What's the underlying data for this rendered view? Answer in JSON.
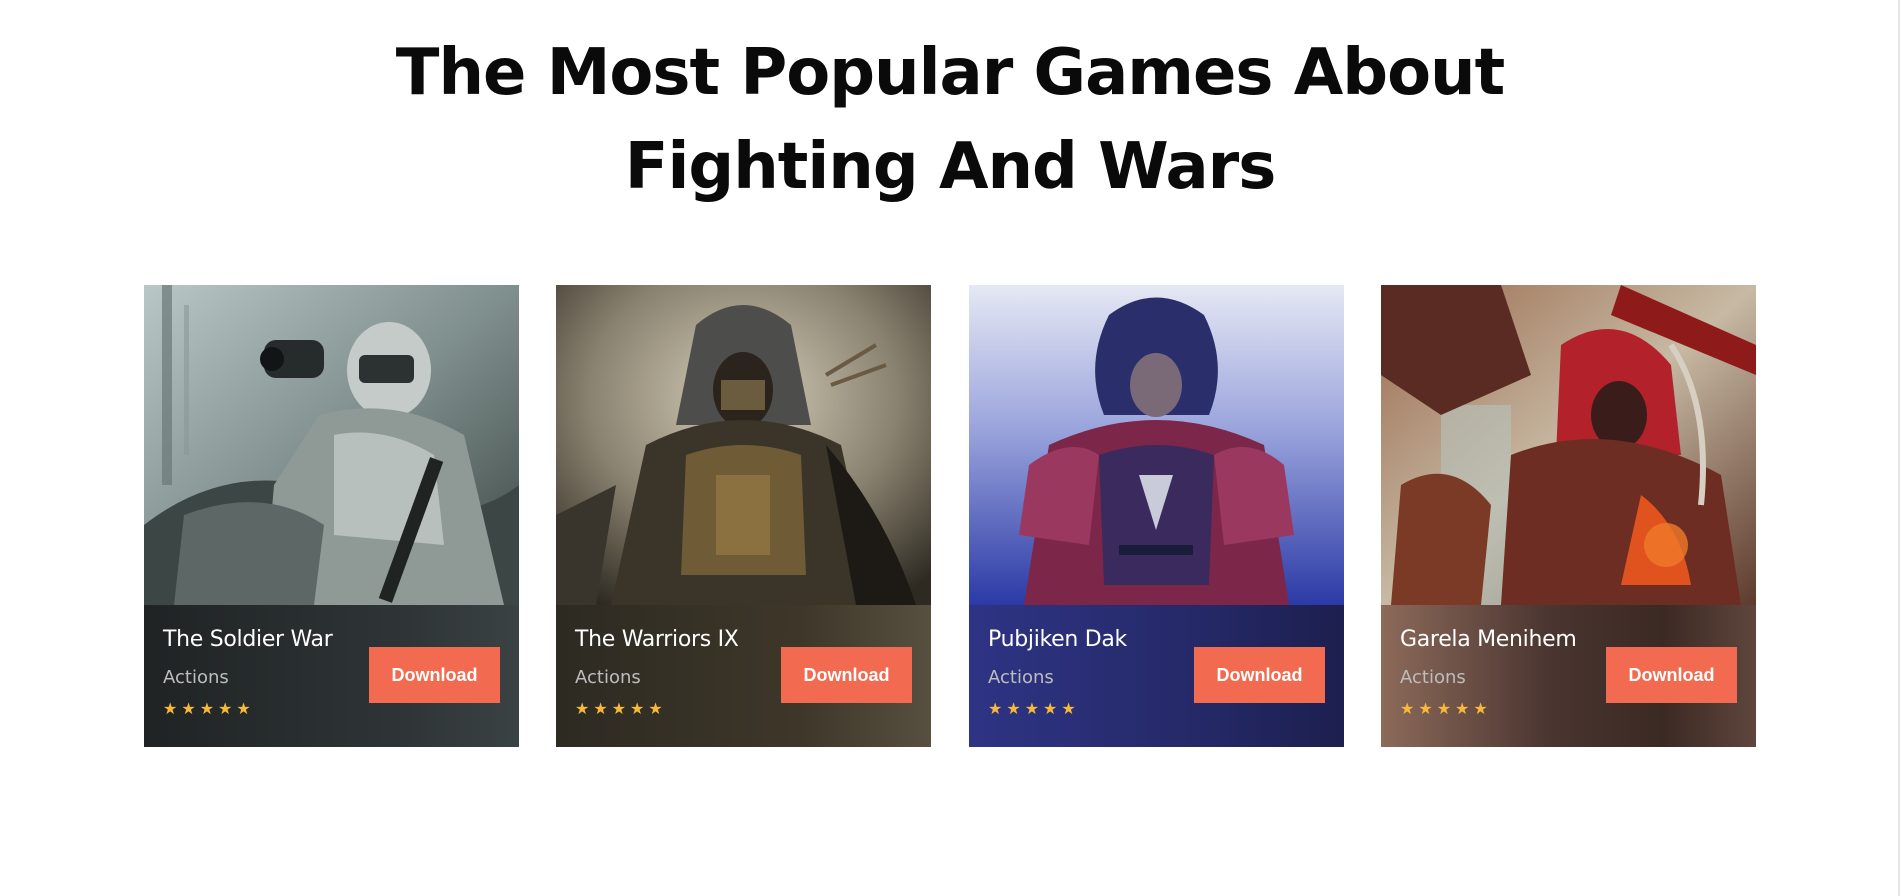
{
  "heading": {
    "line1": "The Most Popular Games About",
    "line2": "Fighting And Wars"
  },
  "cards": [
    {
      "title": "The Soldier War",
      "genre": "Actions",
      "stars": "★★★★★",
      "rating": 5,
      "button_label": "Download",
      "footer_color": "#2c3031"
    },
    {
      "title": "The Warriors IX",
      "genre": "Actions",
      "stars": "★★★★★",
      "rating": 5,
      "button_label": "Download",
      "footer_color": "#3d3528"
    },
    {
      "title": "Pubjiken Dak",
      "genre": "Actions",
      "stars": "★★★★★",
      "rating": 5,
      "button_label": "Download",
      "footer_color": "#262a63"
    },
    {
      "title": "Garela Menihem",
      "genre": "Actions",
      "stars": "★★★★★",
      "rating": 5,
      "button_label": "Download",
      "footer_color": "#4a3530"
    }
  ],
  "colors": {
    "button": "#f26a4f",
    "star": "#f6b93b",
    "heading": "#0a0a0a"
  }
}
